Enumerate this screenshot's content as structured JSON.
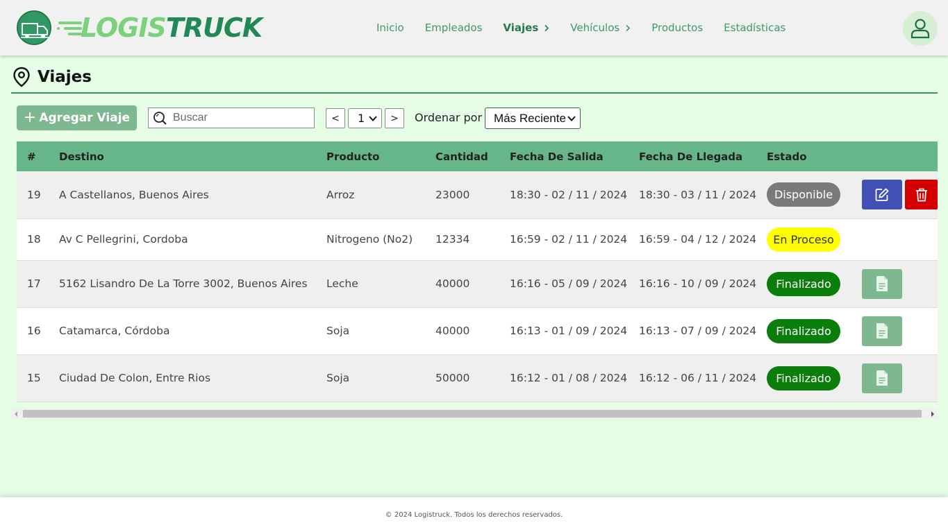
{
  "brand": {
    "name_part1": "LOGIS",
    "name_part2": "TRUCK",
    "colors": {
      "primary": "#1f8a56",
      "light": "#7cd17c",
      "header_bg": "#f1f1f1",
      "page_bg": "#e6fde6"
    }
  },
  "nav": {
    "items": [
      {
        "label": "Inicio",
        "active": false,
        "has_chevron": false
      },
      {
        "label": "Empleados",
        "active": false,
        "has_chevron": false
      },
      {
        "label": "Viajes",
        "active": true,
        "has_chevron": true
      },
      {
        "label": "Vehículos",
        "active": false,
        "has_chevron": true
      },
      {
        "label": "Productos",
        "active": false,
        "has_chevron": false
      },
      {
        "label": "Estadísticas",
        "active": false,
        "has_chevron": false
      }
    ],
    "user_icon": "user-icon"
  },
  "page": {
    "title": "Viajes",
    "title_icon": "map-pin-icon"
  },
  "toolbar": {
    "add_label": "Agregar Viaje",
    "search_placeholder": "Buscar",
    "prev_label": "<",
    "next_label": ">",
    "page_value": "1",
    "sort_label": "Ordenar por",
    "sort_value": "Más Reciente"
  },
  "table": {
    "headers": [
      "#",
      "Destino",
      "Producto",
      "Cantidad",
      "Fecha De Salida",
      "Fecha De Llegada",
      "Estado",
      ""
    ],
    "rows": [
      {
        "id": "19",
        "destino": "A Castellanos, Buenos Aires",
        "producto": "Arroz",
        "cantidad": "23000",
        "salida": "18:30 - 02 / 11 / 2024",
        "llegada": "18:30 - 03 / 11 / 2024",
        "estado": "Disponible",
        "actions": "edit-delete"
      },
      {
        "id": "18",
        "destino": "Av C Pellegrini, Cordoba",
        "producto": "Nitrogeno (No2)",
        "cantidad": "12334",
        "salida": "16:59 - 02 / 11 / 2024",
        "llegada": "16:59 - 04 / 12 / 2024",
        "estado": "En Proceso",
        "actions": "none"
      },
      {
        "id": "17",
        "destino": "5162 Lisandro De La Torre 3002, Buenos Aires",
        "producto": "Leche",
        "cantidad": "40000",
        "salida": "16:16 - 05 / 09 / 2024",
        "llegada": "16:16 - 10 / 09 / 2024",
        "estado": "Finalizado",
        "actions": "document"
      },
      {
        "id": "16",
        "destino": "Catamarca, Córdoba",
        "producto": "Soja",
        "cantidad": "40000",
        "salida": "16:13 - 01 / 09 / 2024",
        "llegada": "16:13 - 07 / 09 / 2024",
        "estado": "Finalizado",
        "actions": "document"
      },
      {
        "id": "15",
        "destino": "Ciudad De Colon, Entre Rios",
        "producto": "Soja",
        "cantidad": "50000",
        "salida": "16:12 - 01 / 08 / 2024",
        "llegada": "16:12 - 06 / 11 / 2024",
        "estado": "Finalizado",
        "actions": "document"
      }
    ],
    "status_colors": {
      "Disponible": {
        "bg": "#7a7a7a",
        "fg": "#ffffff"
      },
      "En Proceso": {
        "bg": "#ffff00",
        "fg": "#333333"
      },
      "Finalizado": {
        "bg": "#0a7d0a",
        "fg": "#ffffff"
      }
    },
    "action_colors": {
      "edit": "#4050b5",
      "delete": "#d40000",
      "document": "#7db891"
    }
  },
  "footer": {
    "text": "© 2024 Logistruck. Todos los derechos reservados."
  }
}
